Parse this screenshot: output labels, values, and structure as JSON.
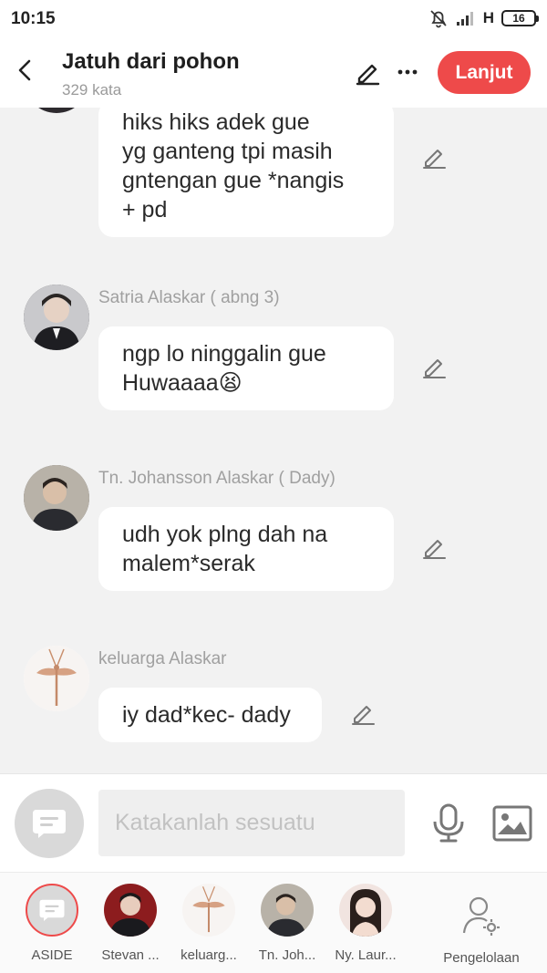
{
  "status": {
    "time": "10:15",
    "network": "H",
    "battery": "16"
  },
  "header": {
    "title": "Jatuh dari pohon",
    "word_count": "329 kata",
    "next_label": "Lanjut"
  },
  "messages": [
    {
      "sender": "",
      "text_lines": [
        "hiks hiks adek gue",
        "yg ganteng tpi masih",
        "gntengan gue *nangis",
        "+ pd"
      ]
    },
    {
      "sender": "Satria Alaskar ( abng 3)",
      "text_lines": [
        "ngp lo ninggalin gue",
        "Huwaaaa😫"
      ]
    },
    {
      "sender": "Tn. Johansson Alaskar ( Dady)",
      "text_lines": [
        "udh yok plng dah na",
        "malem*serak"
      ]
    },
    {
      "sender": "keluarga Alaskar",
      "text_lines": [
        "iy dad*kec- dady"
      ]
    }
  ],
  "input": {
    "placeholder": "Katakanlah sesuatu"
  },
  "characters": [
    {
      "label": "ASIDE"
    },
    {
      "label": "Stevan ..."
    },
    {
      "label": "keluarg..."
    },
    {
      "label": "Tn. Joh..."
    },
    {
      "label": "Ny. Laur..."
    }
  ],
  "manage": {
    "label": "Pengelolaan"
  },
  "colors": {
    "accent": "#ee4a4a",
    "background": "#f2f2f2",
    "bubble": "#ffffff"
  }
}
